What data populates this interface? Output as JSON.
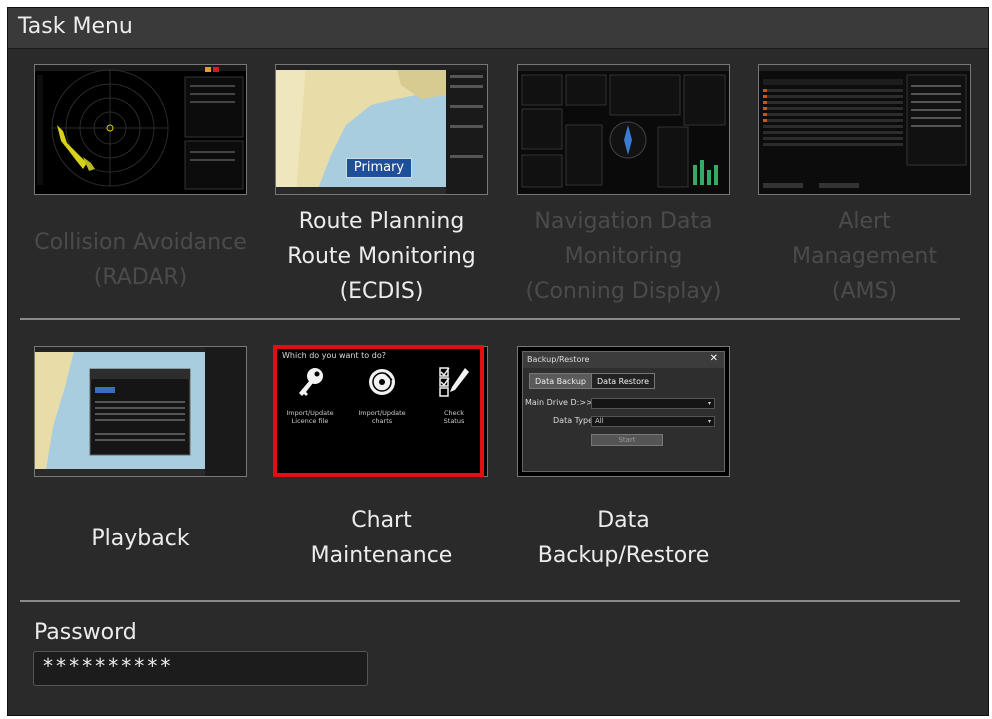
{
  "window": {
    "title": "Task Menu"
  },
  "tasks_row1": [
    {
      "id": "radar",
      "lines": [
        "Collision Avoidance",
        "(RADAR)"
      ],
      "enabled": false
    },
    {
      "id": "ecdis",
      "lines": [
        "Route Planning",
        "Route Monitoring",
        "(ECDIS)"
      ],
      "enabled": true,
      "badge": "Primary"
    },
    {
      "id": "conning",
      "lines": [
        "Navigation Data",
        "Monitoring",
        "(Conning Display)"
      ],
      "enabled": false
    },
    {
      "id": "ams",
      "lines": [
        "Alert",
        "Management",
        "(AMS)"
      ],
      "enabled": false
    }
  ],
  "tasks_row2": [
    {
      "id": "playback",
      "lines": [
        "Playback"
      ],
      "enabled": true
    },
    {
      "id": "chart-maintenance",
      "lines": [
        "Chart",
        "Maintenance"
      ],
      "enabled": true
    },
    {
      "id": "backup",
      "lines": [
        "Data",
        "Backup/Restore"
      ],
      "enabled": true
    }
  ],
  "chart_maintenance_preview": {
    "prompt": "Which do you want to do?",
    "items": [
      {
        "label_lines": [
          "Import/Update",
          "Licence file"
        ],
        "icon": "key-icon"
      },
      {
        "label_lines": [
          "Import/Update",
          "charts"
        ],
        "icon": "disc-icon"
      },
      {
        "label_lines": [
          "Check",
          "Status"
        ],
        "icon": "checklist-icon"
      }
    ]
  },
  "backup_preview": {
    "title": "Backup/Restore",
    "close": "✕",
    "tabs": [
      "Data Backup",
      "Data Restore"
    ],
    "main_drive_label": "Main Drive D:>>",
    "data_type_label": "Data Type",
    "data_type_value": "All",
    "start_label": "Start"
  },
  "password": {
    "label": "Password",
    "value": "**********"
  },
  "colors": {
    "background": "#2a2a2a",
    "text_enabled": "#ececec",
    "text_disabled": "#4b4b4b",
    "highlight": "#e01010",
    "badge": "#1f4f9a"
  }
}
